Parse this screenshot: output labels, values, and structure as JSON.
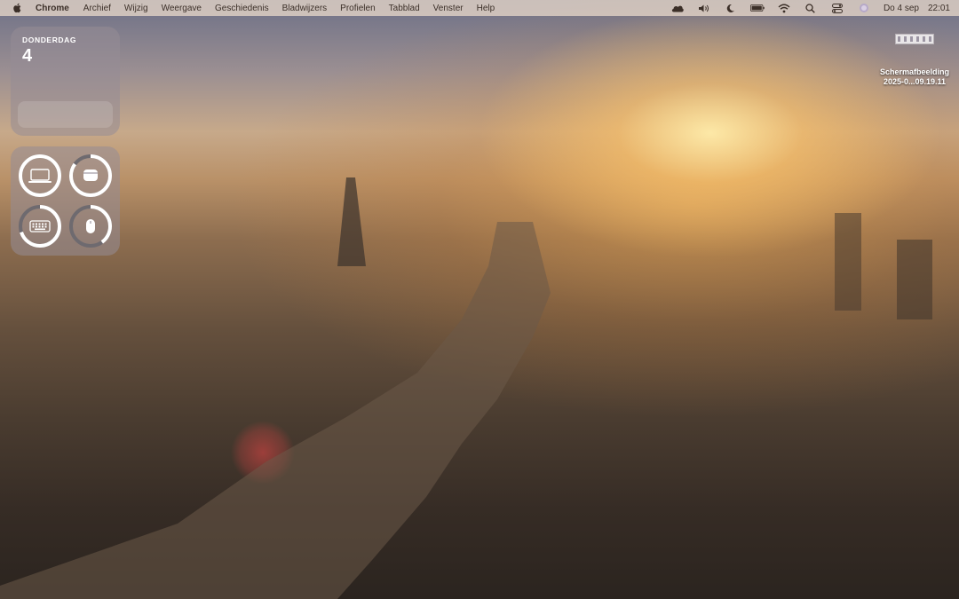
{
  "menubar": {
    "apple_icon": "apple-logo-icon",
    "app_name": "Chrome",
    "items": [
      "Archief",
      "Wijzig",
      "Weergave",
      "Geschiedenis",
      "Bladwijzers",
      "Profielen",
      "Tabblad",
      "Venster",
      "Help"
    ],
    "status_icons": [
      "cloud-icon",
      "volume-icon",
      "moon-icon",
      "battery-icon",
      "wifi-icon",
      "search-icon",
      "control-center-icon",
      "siri-icon"
    ],
    "date": "Do 4 sep",
    "time": "22:01"
  },
  "calendar_widget": {
    "weekday": "DONDERDAG",
    "day": "4"
  },
  "battery_widget": {
    "devices": [
      {
        "name": "laptop-icon",
        "level": 1.0
      },
      {
        "name": "airpods-case-icon",
        "level": 0.85
      },
      {
        "name": "keyboard-icon",
        "level": 0.7
      },
      {
        "name": "mouse-icon",
        "level": 0.4
      }
    ],
    "ring_color": "#ffffff",
    "track_color": "#6e6a6f"
  },
  "desktop_file": {
    "line1": "Schermafbeelding",
    "line2": "2025-0...09.19.11"
  }
}
